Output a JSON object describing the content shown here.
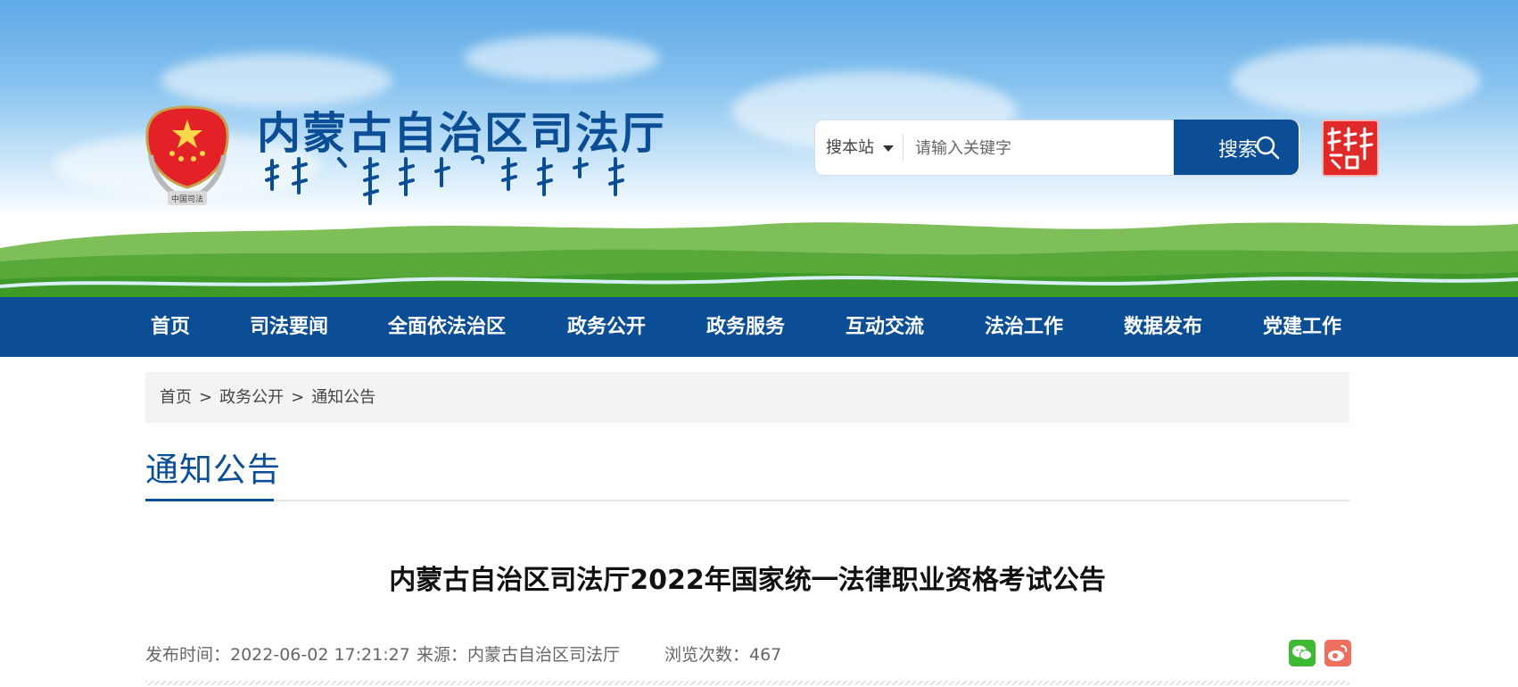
{
  "header": {
    "site_title": "内蒙古自治区司法厅",
    "emblem_text": "中国司法"
  },
  "search": {
    "scope_label": "搜本站",
    "placeholder": "请输入关键字",
    "button_label": "搜索"
  },
  "nav": {
    "items": [
      "首页",
      "司法要闻",
      "全面依法治区",
      "政务公开",
      "政务服务",
      "互动交流",
      "法治工作",
      "数据发布",
      "党建工作"
    ]
  },
  "breadcrumb": {
    "items": [
      "首页",
      "政务公开",
      "通知公告"
    ],
    "separator": ">"
  },
  "section": {
    "title": "通知公告"
  },
  "article": {
    "title": "内蒙古自治区司法厅2022年国家统一法律职业资格考试公告",
    "publish_time": "发布时间：2022-06-02 17:21:27",
    "source": "来源：内蒙古自治区司法厅",
    "views": "浏览次数：467"
  },
  "share": {
    "icons": [
      "wechat-icon",
      "weibo-icon"
    ],
    "colors": {
      "wechat": "#3fb934",
      "weibo": "#ef6f5f"
    }
  },
  "colors": {
    "brand": "#0b4e95",
    "breadcrumb_bg": "#f3f3f3"
  }
}
